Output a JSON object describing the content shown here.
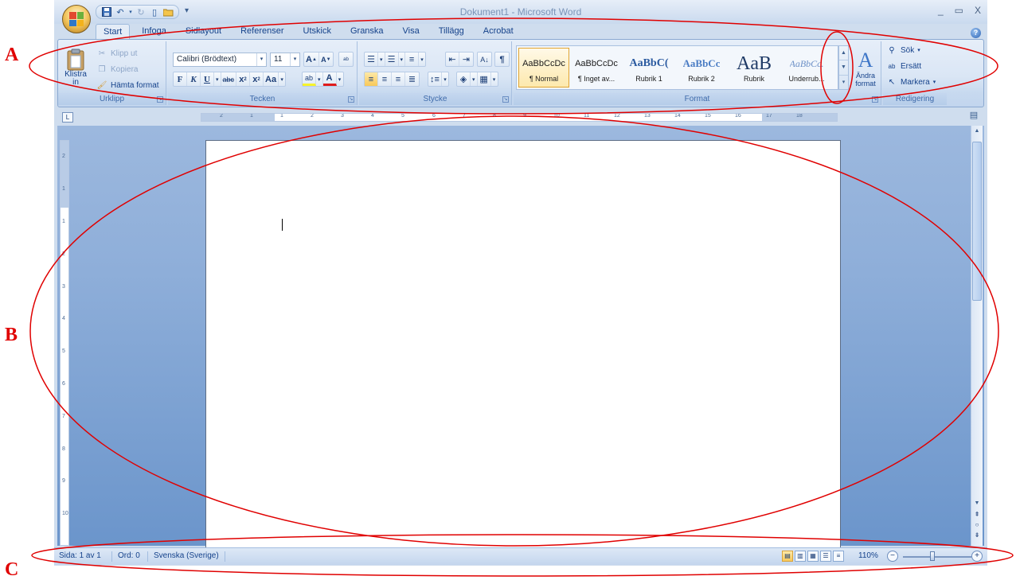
{
  "markers": {
    "a": "A",
    "b": "B",
    "c": "C"
  },
  "window": {
    "title": "Dokument1 - Microsoft Word",
    "controls": [
      "_",
      "▭",
      "X"
    ]
  },
  "tabs": [
    "Start",
    "Infoga",
    "Sidlayout",
    "Referenser",
    "Utskick",
    "Granska",
    "Visa",
    "Tillägg",
    "Acrobat"
  ],
  "active_tab": "Start",
  "clipboard": {
    "paste": "Klistra in",
    "cut": "Klipp ut",
    "copy": "Kopiera",
    "format_painter": "Hämta format",
    "label": "Urklipp"
  },
  "font": {
    "name": "Calibri (Brödtext)",
    "size": "11",
    "label": "Tecken"
  },
  "paragraph": {
    "label": "Stycke"
  },
  "styles": {
    "items": [
      {
        "preview": "AaBbCcDc",
        "name": "¶ Normal"
      },
      {
        "preview": "AaBbCcDc",
        "name": "¶ Inget av..."
      },
      {
        "preview": "AaBbC(",
        "name": "Rubrik 1"
      },
      {
        "preview": "AaBbCc",
        "name": "Rubrik 2"
      },
      {
        "preview": "AaB",
        "name": "Rubrik"
      },
      {
        "preview": "AaBbCc.",
        "name": "Underrub..."
      }
    ],
    "change_styles": "Ändra format",
    "label": "Format"
  },
  "editing": {
    "find": "Sök",
    "replace": "Ersätt",
    "select": "Markera",
    "label": "Redigering"
  },
  "ruler_numbers": [
    "2",
    "1",
    "1",
    "2",
    "3",
    "4",
    "5",
    "6",
    "7",
    "8",
    "9",
    "10",
    "11",
    "12",
    "13",
    "14",
    "15",
    "16",
    "17",
    "18"
  ],
  "vruler_numbers": [
    "2",
    "1",
    "1",
    "2",
    "3",
    "4",
    "5",
    "6",
    "7",
    "8",
    "9",
    "10"
  ],
  "status": {
    "page": "Sida: 1 av 1",
    "words": "Ord: 0",
    "language": "Svenska (Sverige)",
    "zoom": "110%"
  },
  "colors": {
    "annotation": "#e00000",
    "ribbon_text": "#15428b",
    "selected": "#f8c85a"
  }
}
